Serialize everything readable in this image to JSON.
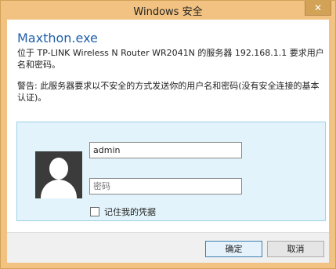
{
  "window": {
    "title": "Windows 安全",
    "close_label": "✕"
  },
  "app": {
    "name": "Maxthon.exe"
  },
  "message": "位于 TP-LINK Wireless N Router WR2041N 的服务器 192.168.1.1 要求用户名和密码。",
  "warning": "警告: 此服务器要求以不安全的方式发送你的用户名和密码(没有安全连接的基本认证)。",
  "credentials": {
    "avatar_icon": "user-avatar-icon",
    "username_value": "admin",
    "password_placeholder": "密码",
    "remember_label": "记住我的凭据",
    "remember_checked": false
  },
  "buttons": {
    "ok": "确定",
    "cancel": "取消"
  }
}
